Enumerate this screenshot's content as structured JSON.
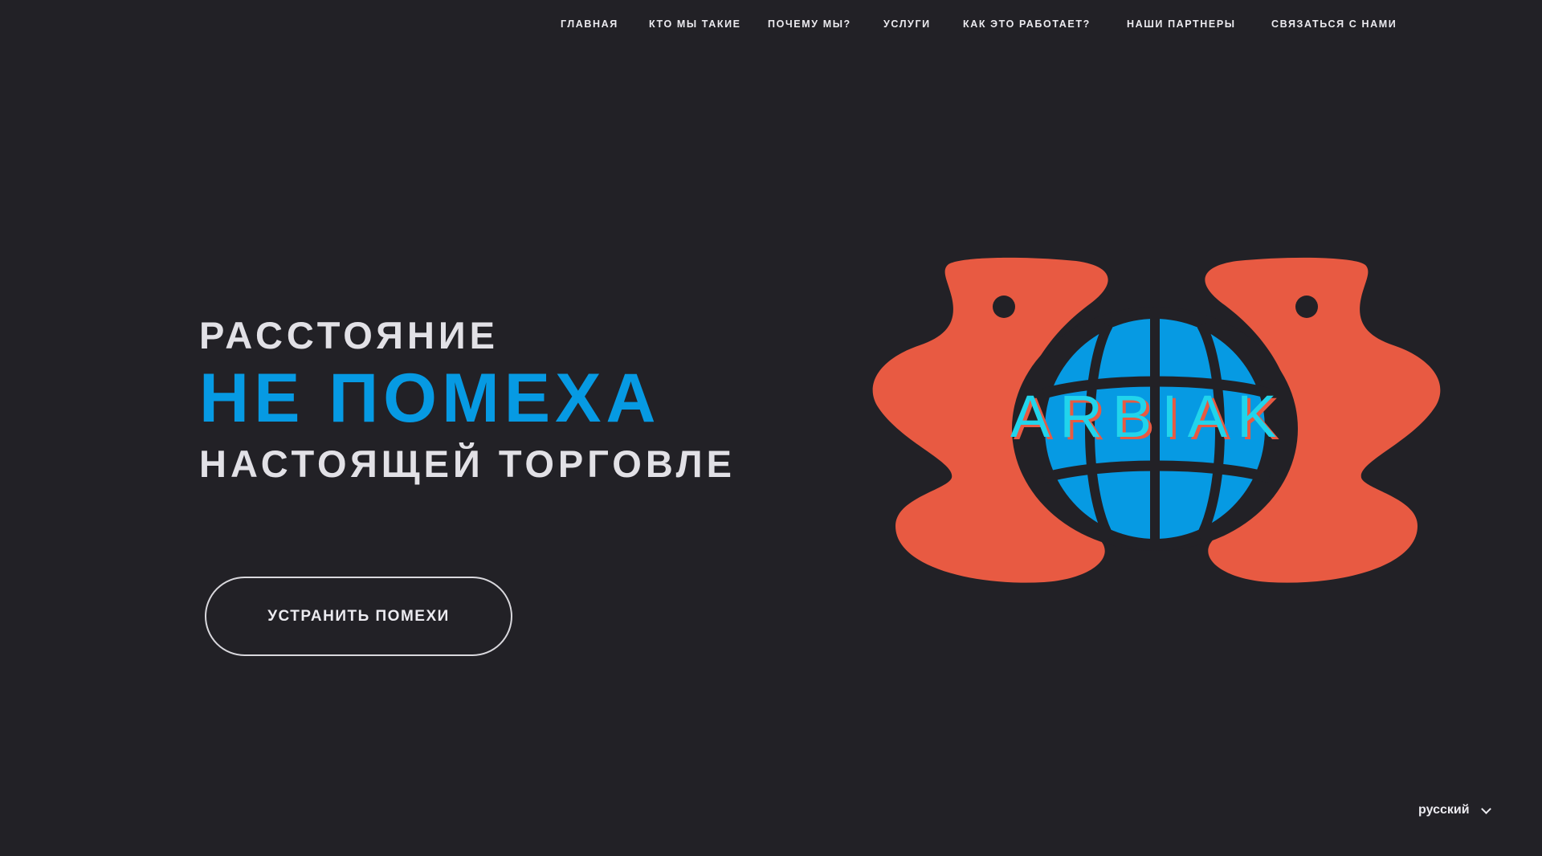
{
  "nav": {
    "items": [
      {
        "label": "ГЛАВНАЯ"
      },
      {
        "label": "КТО МЫ ТАКИЕ"
      },
      {
        "label": "ПОЧЕМУ МЫ?"
      },
      {
        "label": "УСЛУГИ"
      },
      {
        "label": "КАК ЭТО РАБОТАЕТ?"
      },
      {
        "label": "НАШИ ПАРТНЕРЫ"
      },
      {
        "label": "СВЯЗАТЬСЯ С НАМИ"
      }
    ]
  },
  "hero": {
    "line1": "РАССТОЯНИЕ",
    "line2": "НЕ ПОМЕХА",
    "line3": "НАСТОЯЩЕЙ ТОРГОВЛЕ",
    "cta_label": "УСТРАНИТЬ ПОМЕХИ"
  },
  "logo": {
    "wordmark": "ARBIAK",
    "icon": "globe-icon"
  },
  "language": {
    "selected": "русский",
    "icon": "chevron-down-icon"
  },
  "colors": {
    "background": "#222126",
    "accent_blue": "#069ae3",
    "accent_coral": "#e85a42",
    "wordmark_cyan": "#21d4ec",
    "text_light": "#e2e1e6"
  }
}
